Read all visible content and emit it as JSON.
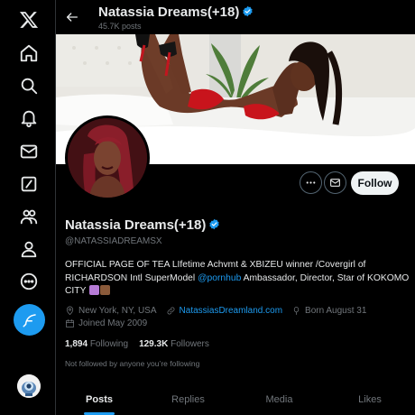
{
  "nav": {
    "items": [
      "x-logo",
      "home",
      "explore",
      "notifications",
      "messages",
      "grok",
      "communities",
      "profile",
      "more"
    ]
  },
  "header": {
    "title": "Natassia Dreams(+18)",
    "post_count": "45.7K posts"
  },
  "profile": {
    "name": "Natassia Dreams(+18)",
    "handle": "@NATASSIADREAMSX",
    "follow_label": "Follow",
    "bio_part1": "OFFICIAL PAGE OF TEA LIfetime Achvmt  & XBIZEU winner /Covergirl of RICHARDSON Intl SuperModel ",
    "bio_link": "@pornhub",
    "bio_part2": " Ambassador, Director, Star of KOKOMO CITY",
    "location": "New York, NY, USA",
    "website": "NatassiasDreamland.com",
    "birthday": "Born August 31",
    "joined": "Joined May 2009",
    "following_count": "1,894",
    "following_label": "Following",
    "followers_count": "129.3K",
    "followers_label": "Followers",
    "not_followed": "Not followed by anyone you’re following"
  },
  "tabs": [
    "Posts",
    "Replies",
    "Media",
    "Likes"
  ],
  "colors": {
    "accent": "#1d9bf0",
    "background": "#000000",
    "text": "#e7e9ea",
    "muted": "#71767b"
  }
}
